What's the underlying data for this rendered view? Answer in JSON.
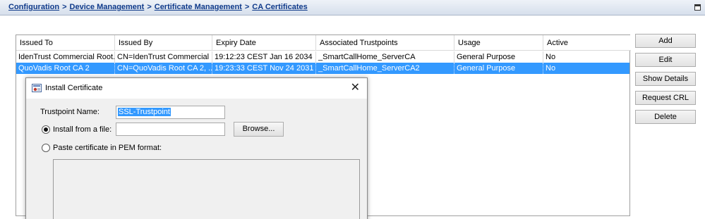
{
  "breadcrumb": {
    "part1": "Configuration",
    "sep1": ">",
    "part2": "Device Management",
    "sep2": ">",
    "part3": "Certificate Management",
    "sep3": ">",
    "current": "CA Certificates"
  },
  "table": {
    "headers": [
      "Issued To",
      "Issued By",
      "Expiry Date",
      "Associated Trustpoints",
      "Usage",
      "Active"
    ],
    "rows": [
      [
        "IdenTrust Commercial Root...",
        "CN=IdenTrust Commercial ...",
        "19:12:23 CEST Jan 16 2034",
        "_SmartCallHome_ServerCA",
        "General Purpose",
        "No"
      ],
      [
        "QuoVadis Root CA 2",
        "CN=QuoVadis Root CA 2, ...",
        "19:23:33 CEST Nov 24 2031",
        "_SmartCallHome_ServerCA2",
        "General Purpose",
        "No"
      ]
    ],
    "selected_row": 1
  },
  "actions": {
    "add": "Add",
    "edit": "Edit",
    "show_details": "Show Details",
    "request_crl": "Request CRL",
    "delete": "Delete"
  },
  "dialog": {
    "title": "Install Certificate",
    "close_glyph": "✕",
    "trustpoint_label": "Trustpoint Name:",
    "trustpoint_value": "SSL-Trustpoint",
    "install_file_label": "Install from a file:",
    "install_file_value": "",
    "browse_label": "Browse...",
    "paste_label": "Paste certificate in PEM format:",
    "install_file_selected": true
  },
  "colors": {
    "selection": "#3399ff",
    "crumb_link": "#0f3a8a"
  }
}
